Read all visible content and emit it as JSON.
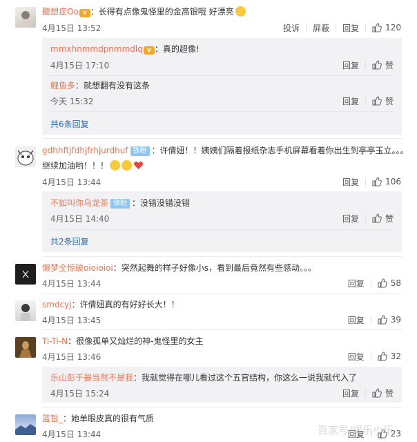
{
  "colors": {
    "username": "#eb7350",
    "link": "#2a6cb0",
    "reply_bg": "#f2f2f5",
    "badge": "#8ec7f5"
  },
  "actions": {
    "report": "投诉",
    "block": "屏蔽",
    "reply": "回复",
    "like": "赞"
  },
  "comments": [
    {
      "user": "聽想症Oo",
      "text": "：长得有点像鬼怪里的金高银哦 好漂亮",
      "time": "4月15日 13:52",
      "likes": "120",
      "replies": [
        {
          "user": "mmxhnmmdpnmmdlq",
          "text": "：真的超像!",
          "time": "4月15日 17:10",
          "likes": "赞"
        },
        {
          "user": "鲤鱼多",
          "text": "：就想翻有没有这条",
          "time": "今天 15:32",
          "likes": "赞"
        }
      ],
      "more": "共6条回复"
    },
    {
      "user": "gdhhftjfdhjfrhjurdhuf",
      "badge": "铁粉",
      "text": "：许倩妞！！姨姨们隔着报纸杂志手机屏幕看着你出生到亭亭玉立。。。",
      "text2": "继续加油哟！！！",
      "time": "4月15日 13:44",
      "likes": "106",
      "replies": [
        {
          "user": "不如叫你乌龙茶",
          "badge": "铁粉",
          "text": "：没错没错没错",
          "time": "4月15日 14:40",
          "likes": "赞"
        }
      ],
      "more": "共2条回复"
    },
    {
      "user": "懒梦全惊破oioioioi",
      "text": "：突然起舞的样子好像小s，看到最后竟然有些感动。。。",
      "time": "4月15日 13:44",
      "likes": "58"
    },
    {
      "user": "smdcyj",
      "text": "：许倩妞真的有好好长大！！",
      "time": "4月15日 13:45",
      "likes": "39"
    },
    {
      "user": "Ti-Ti-N",
      "text": "：很像孤单又灿烂的神-鬼怪里的女主",
      "time": "4月15日 13:46",
      "likes": "32",
      "replies": [
        {
          "user": "乐山彭于晏当然不是我",
          "text": "：我就觉得在哪儿看过这个五官结构，你这么一说我就代入了",
          "time": "4月15日 15:24",
          "likes": "赞"
        }
      ]
    },
    {
      "user": "蓝晢_",
      "text": "：她单眼皮真的很有气质",
      "time": "4月15日 13:44",
      "likes": "23"
    }
  ],
  "watermark": "百家号/娱乐小乐"
}
